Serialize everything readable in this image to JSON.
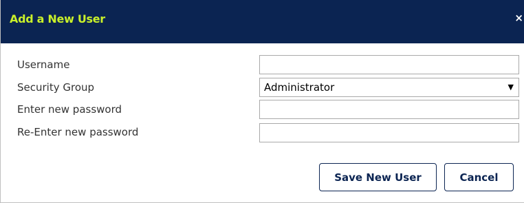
{
  "dialog": {
    "title": "Add a New User",
    "close_label": "×"
  },
  "form": {
    "username": {
      "label": "Username",
      "value": "",
      "placeholder": ""
    },
    "security_group": {
      "label": "Security Group",
      "selected": "Administrator"
    },
    "password": {
      "label": "Enter new password",
      "value": "",
      "placeholder": ""
    },
    "password_confirm": {
      "label": "Re-Enter new password",
      "value": "",
      "placeholder": ""
    }
  },
  "buttons": {
    "save_label": "Save New User",
    "cancel_label": "Cancel"
  },
  "icons": {
    "close": "close-icon",
    "dropdown": "chevron-down-icon"
  },
  "colors": {
    "header_bg": "#0b2452",
    "title_text": "#c9f02a",
    "button_text": "#0b2452"
  }
}
